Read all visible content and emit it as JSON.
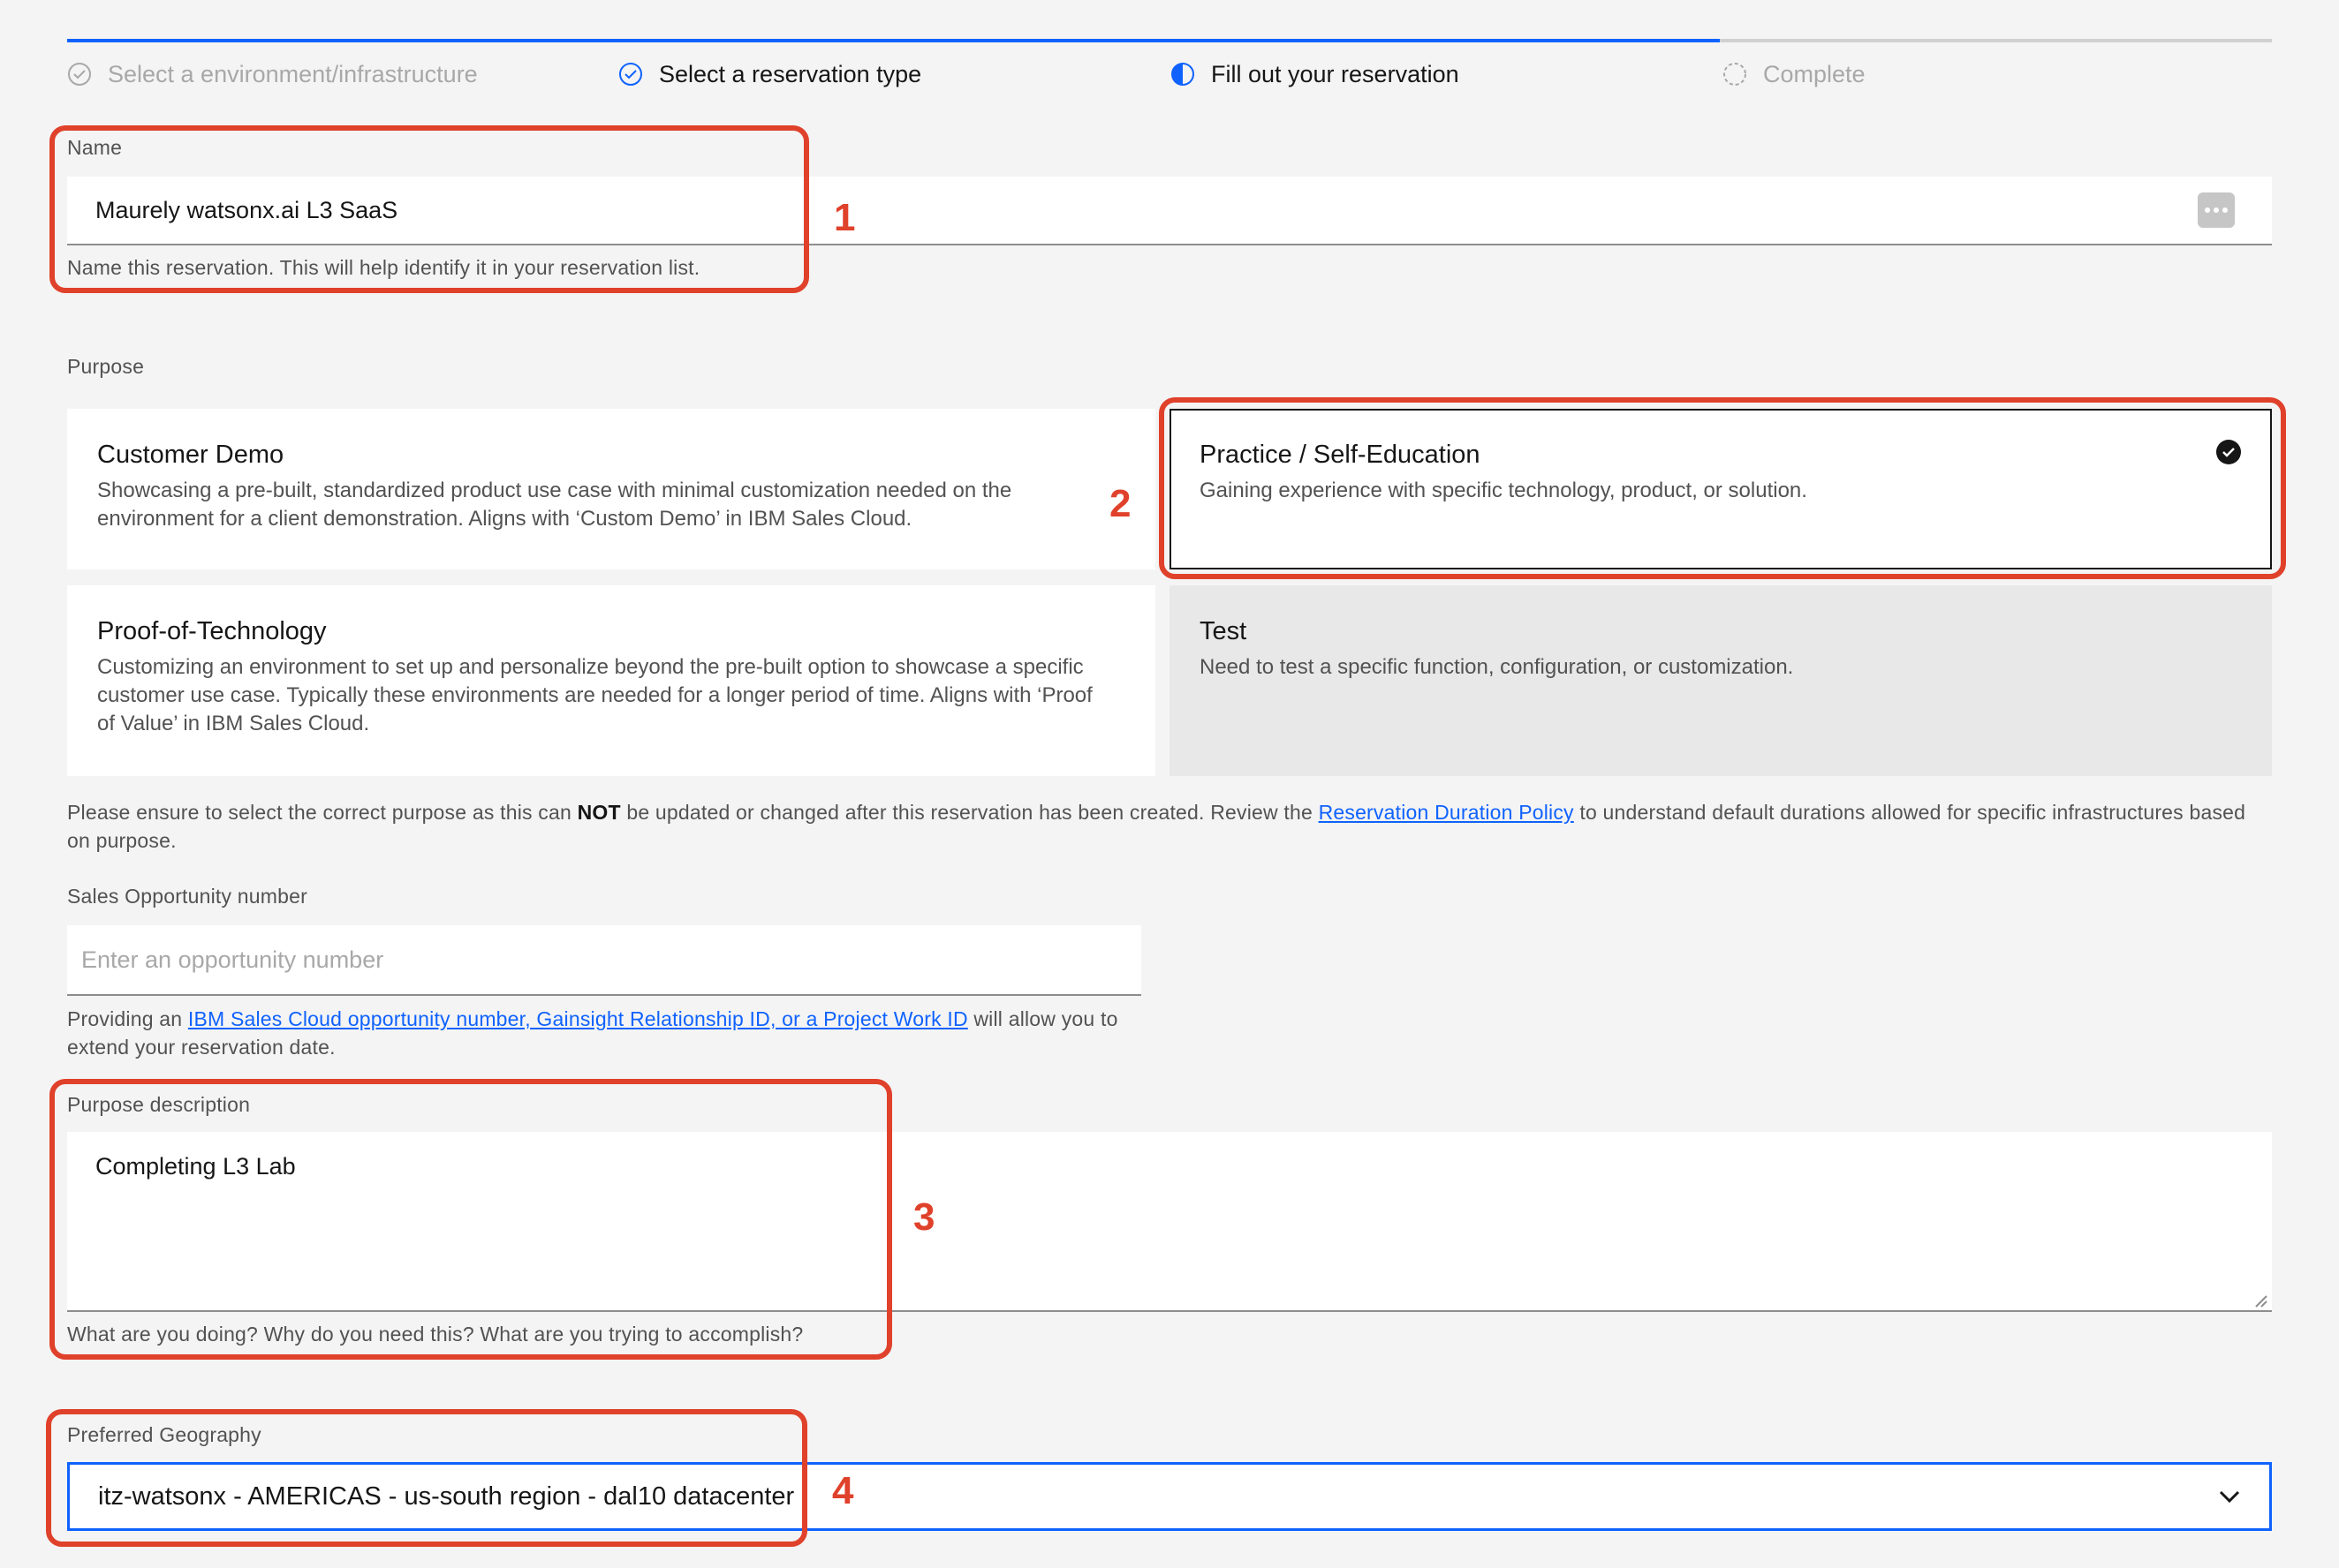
{
  "progress": {
    "steps": [
      {
        "label": "Select a environment/infrastructure",
        "state": "complete"
      },
      {
        "label": "Select a reservation type",
        "state": "complete"
      },
      {
        "label": "Fill out your reservation",
        "state": "current"
      },
      {
        "label": "Complete",
        "state": "incomplete"
      }
    ]
  },
  "name_field": {
    "label": "Name",
    "value": "Maurely watsonx.ai L3 SaaS",
    "helper": "Name this reservation. This will help identify it in your reservation list.",
    "password_icon": "more-dots-icon"
  },
  "purpose": {
    "label": "Purpose",
    "options": [
      {
        "title": "Customer Demo",
        "description": "Showcasing a pre-built, standardized product use case with minimal customization needed on the environment for a client demonstration. Aligns with ‘Custom Demo’ in IBM Sales Cloud.",
        "selected": false,
        "disabled": false
      },
      {
        "title": "Practice / Self-Education",
        "description": "Gaining experience with specific technology, product, or solution.",
        "selected": true,
        "disabled": false
      },
      {
        "title": "Proof-of-Technology",
        "description": "Customizing an environment to set up and personalize beyond the pre-built option to showcase a specific customer use case. Typically these environments are needed for a longer period of time. Aligns with ‘Proof of Value’ in IBM Sales Cloud.",
        "selected": false,
        "disabled": false
      },
      {
        "title": "Test",
        "description": "Need to test a specific function, configuration, or customization.",
        "selected": false,
        "disabled": true
      }
    ],
    "notice_before": "Please ensure to select the correct purpose as this can ",
    "notice_bold": "NOT",
    "notice_middle": " be updated or changed after this reservation has been created. Review the ",
    "notice_link": "Reservation Duration Policy",
    "notice_after": " to understand default durations allowed for specific infrastructures based on purpose."
  },
  "opportunity": {
    "label": "Sales Opportunity number",
    "placeholder": "Enter an opportunity number",
    "helper_before": "Providing an ",
    "helper_link": "IBM Sales Cloud opportunity number, Gainsight Relationship ID, or a Project Work ID",
    "helper_after": " will allow you to extend your reservation date."
  },
  "purpose_description": {
    "label": "Purpose description",
    "value": "Completing L3 Lab",
    "helper": "What are you doing? Why do you need this? What are you trying to accomplish?"
  },
  "geography": {
    "label": "Preferred Geography",
    "value": "itz-watsonx - AMERICAS - us-south region - dal10 datacenter"
  },
  "annotations": [
    "1",
    "2",
    "3",
    "4"
  ],
  "colors": {
    "accent": "#0f62fe",
    "annotation": "#e0412b",
    "background": "#f4f4f4"
  }
}
